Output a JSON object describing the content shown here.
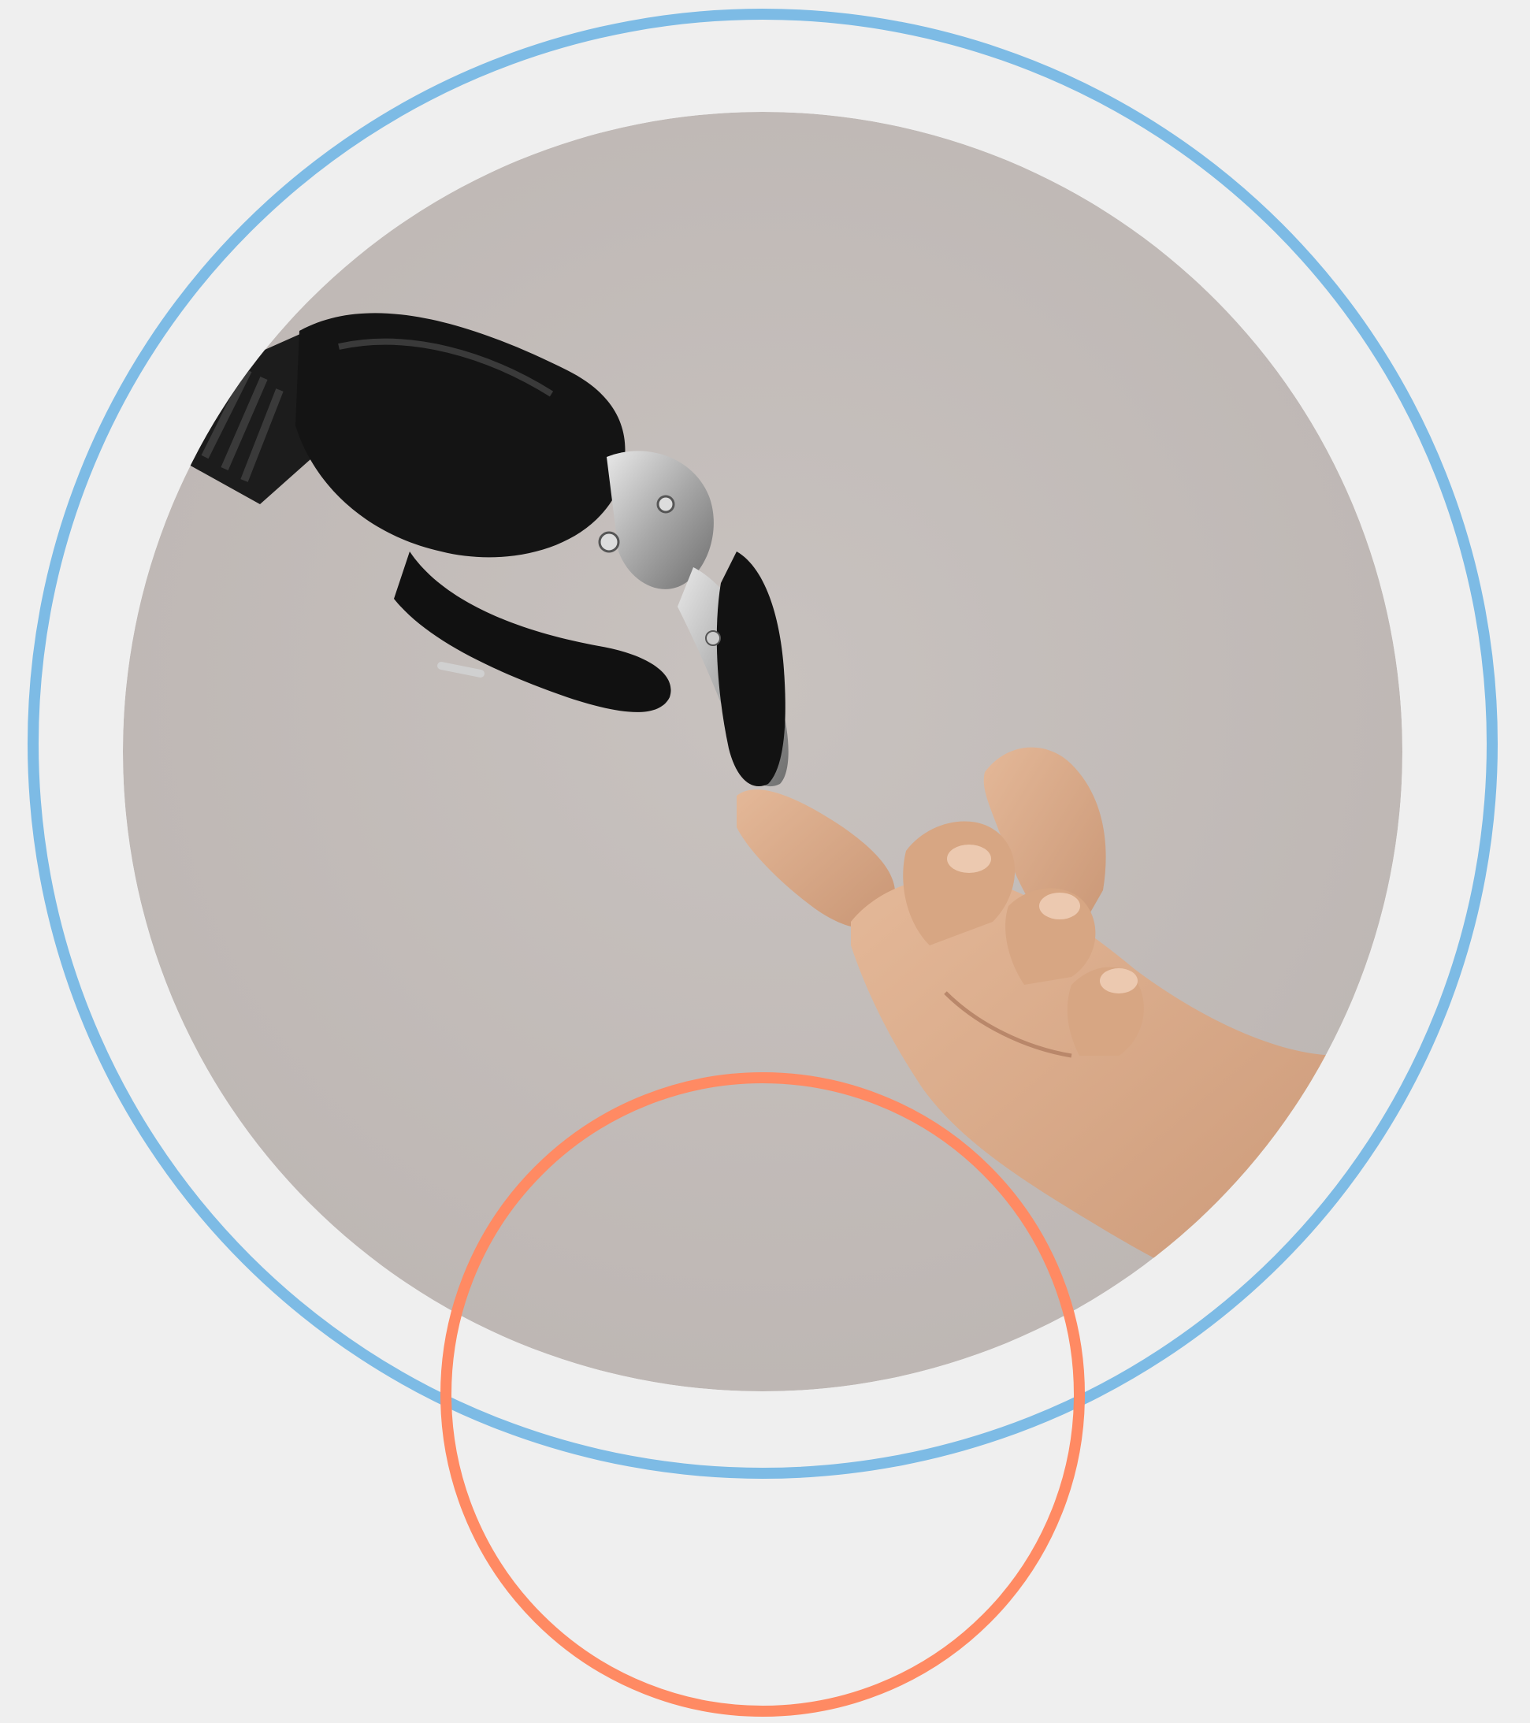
{
  "image": {
    "subject": "robot-hand-touching-human-finger",
    "colors": {
      "page_background": "#efefef",
      "photo_background": "#c3bdba",
      "outer_ring": "#7dbbe5",
      "accent_ring": "#ff8a63",
      "robot_hand": "#141414",
      "robot_metal": "#b9b9b9",
      "human_hand": "#d9aa87"
    }
  }
}
